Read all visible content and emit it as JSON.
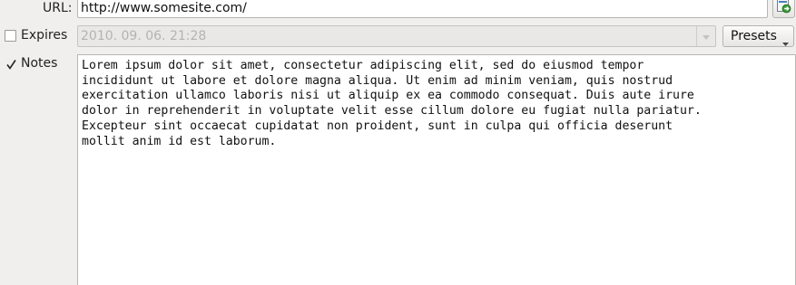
{
  "url": {
    "label": "URL:",
    "value": "http://www.somesite.com/",
    "go_icon": "refresh-page-icon"
  },
  "expires": {
    "label": "Expires",
    "checked": false,
    "date_value": "2010. 09. 06. 21:28",
    "presets_label": "Presets"
  },
  "notes": {
    "label": "Notes",
    "checked": true,
    "text": "Lorem ipsum dolor sit amet, consectetur adipiscing elit, sed do eiusmod tempor\nincididunt ut labore et dolore magna aliqua. Ut enim ad minim veniam, quis nostrud\nexercitation ullamco laboris nisi ut aliquip ex ea commodo consequat. Duis aute irure\ndolor in reprehenderit in voluptate velit esse cillum dolore eu fugiat nulla pariatur.\nExcepteur sint occaecat cupidatat non proident, sunt in culpa qui officia deserunt\nmollit anim id est laborum."
  },
  "colors": {
    "window_bg": "#f0efee",
    "field_border": "#b8b6b3",
    "disabled_text": "#b5b3b0",
    "icon_green": "#3a9a3a",
    "icon_blue": "#4a7fc0"
  }
}
